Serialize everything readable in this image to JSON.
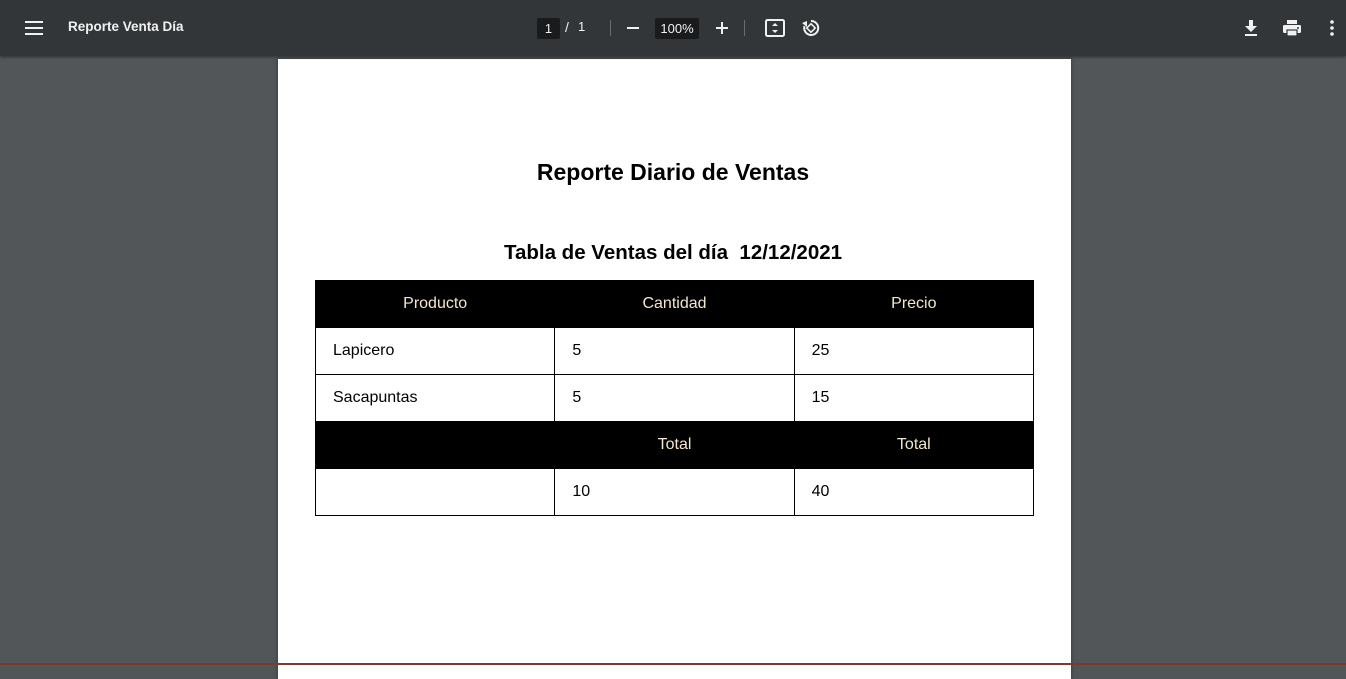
{
  "toolbar": {
    "title": "Reporte Venta Día",
    "current_page": "1",
    "separator": "/",
    "total_pages": "1",
    "zoom": "100%",
    "icons": [
      "menu-icon",
      "zoom-out-icon",
      "zoom-in-icon",
      "fit-page-icon",
      "rotate-icon",
      "download-icon",
      "print-icon",
      "more-vertical-icon"
    ]
  },
  "document": {
    "heading": "Reporte Diario de Ventas",
    "subheading": "Tabla de Ventas del día  12/12/2021",
    "table": {
      "headers": [
        "Producto",
        "Cantidad",
        "Precio"
      ],
      "rows": [
        [
          "Lapicero",
          "5",
          "25"
        ],
        [
          "Sacapuntas",
          "5",
          "15"
        ]
      ],
      "total_headers": [
        "",
        "Total",
        "Total"
      ],
      "totals": [
        "",
        "10",
        "40"
      ]
    }
  },
  "colors": {
    "toolbar_bg": "#323639",
    "viewer_bg": "#525659",
    "table_header_bg": "#000000",
    "table_header_text": "#f3e7cc"
  }
}
